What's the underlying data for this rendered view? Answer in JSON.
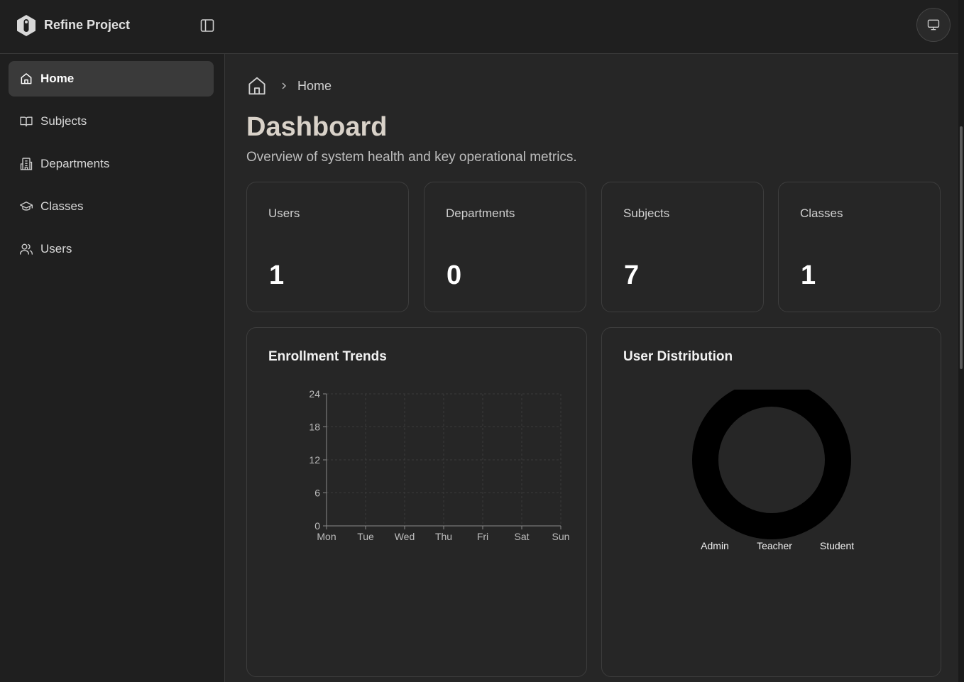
{
  "app": {
    "brand": "Refine Project"
  },
  "sidebar": {
    "items": [
      {
        "label": "Home",
        "icon": "home-icon",
        "active": true
      },
      {
        "label": "Subjects",
        "icon": "book-icon",
        "active": false
      },
      {
        "label": "Departments",
        "icon": "building-icon",
        "active": false
      },
      {
        "label": "Classes",
        "icon": "graduation-cap-icon",
        "active": false
      },
      {
        "label": "Users",
        "icon": "users-icon",
        "active": false
      }
    ]
  },
  "breadcrumb": {
    "current": "Home"
  },
  "page": {
    "title": "Dashboard",
    "subtitle": "Overview of system health and key operational metrics."
  },
  "stats": [
    {
      "label": "Users",
      "value": "1"
    },
    {
      "label": "Departments",
      "value": "0"
    },
    {
      "label": "Subjects",
      "value": "7"
    },
    {
      "label": "Classes",
      "value": "1"
    }
  ],
  "enrollment": {
    "title": "Enrollment Trends"
  },
  "distribution": {
    "title": "User Distribution"
  },
  "chart_data": [
    {
      "type": "line",
      "title": "Enrollment Trends",
      "categories": [
        "Mon",
        "Tue",
        "Wed",
        "Thu",
        "Fri",
        "Sat",
        "Sun"
      ],
      "yticks": [
        0,
        6,
        12,
        18,
        24
      ],
      "ylim": [
        0,
        24
      ],
      "grid": true,
      "series": []
    },
    {
      "type": "pie",
      "title": "User Distribution",
      "legend": [
        "Admin",
        "Teacher",
        "Student"
      ],
      "ring_color": "#000000"
    }
  ],
  "colors": {
    "background": "#262626",
    "sidebar": "#1f1f1f",
    "active_item": "#3a3a3a",
    "title": "#d9d2c9"
  }
}
